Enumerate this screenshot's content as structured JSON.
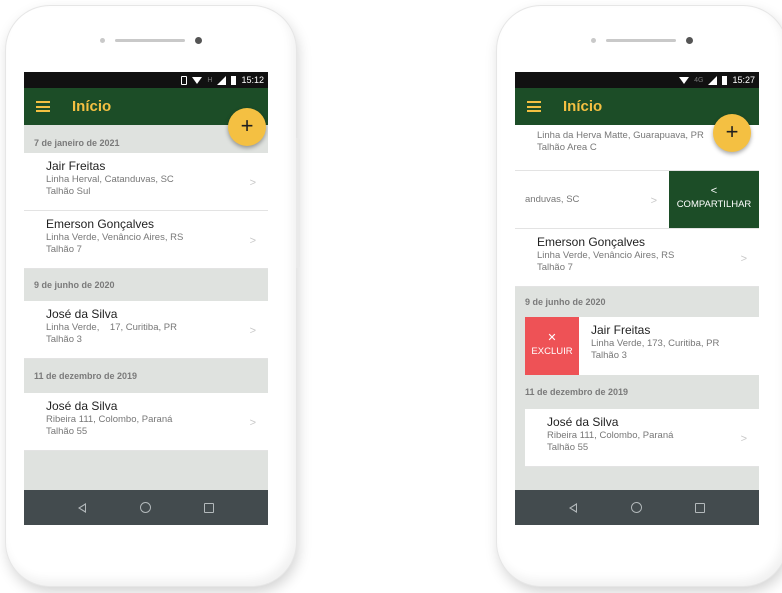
{
  "app": {
    "title": "Início",
    "add_label": "+"
  },
  "left_phone": {
    "status": {
      "time": "15:12",
      "network": "H"
    },
    "sections": [
      {
        "date": "7 de janeiro de 2021",
        "items": [
          {
            "name": "Jair Freitas",
            "address": "Linha Herval, Catanduvas, SC",
            "plot": "Talhão Sul"
          },
          {
            "name": "Emerson Gonçalves",
            "address": "Linha Verde,  Venâncio Aires, RS",
            "plot": "Talhão 7"
          }
        ]
      },
      {
        "date": "9 de junho de 2020",
        "items": [
          {
            "name": "José da Silva",
            "address": "Linha Verde,    17, Curitiba, PR",
            "plot": "Talhão 3"
          }
        ]
      },
      {
        "date": "11 de dezembro de 2019",
        "items": [
          {
            "name": "José da Silva",
            "address": "Ribeira 111, Colombo, Paraná",
            "plot": "Talhão 55"
          }
        ]
      }
    ]
  },
  "right_phone": {
    "status": {
      "time": "15:27",
      "network": "4G"
    },
    "partial_card": {
      "address": "Linha da Herva Matte, Guarapuava, PR",
      "plot": "Talhão Area C"
    },
    "swiped_share_row": {
      "address_fragment": "anduvas, SC",
      "action_label": "COMPARTILHAR"
    },
    "card_emerson": {
      "name": "Emerson Gonçalves",
      "address": "Linha Verde,  Venâncio Aires, RS",
      "plot": "Talhão 7"
    },
    "section_june": {
      "date": "9 de junho de 2020"
    },
    "swiped_delete_row": {
      "action_label": "EXCLUIR",
      "name": "Jair Freitas",
      "address": "Linha Verde, 173, Curitiba, PR",
      "plot": "Talhão 3"
    },
    "section_december": {
      "date": "11 de dezembro de 2019"
    },
    "card_jose": {
      "name": "José da Silva",
      "address": "Ribeira 111, Colombo, Paraná",
      "plot": "Talhão 55"
    }
  },
  "colors": {
    "app_bar": "#1c4d27",
    "accent": "#f4c042",
    "delete": "#ee5256",
    "nav_bar": "#434b4e"
  }
}
